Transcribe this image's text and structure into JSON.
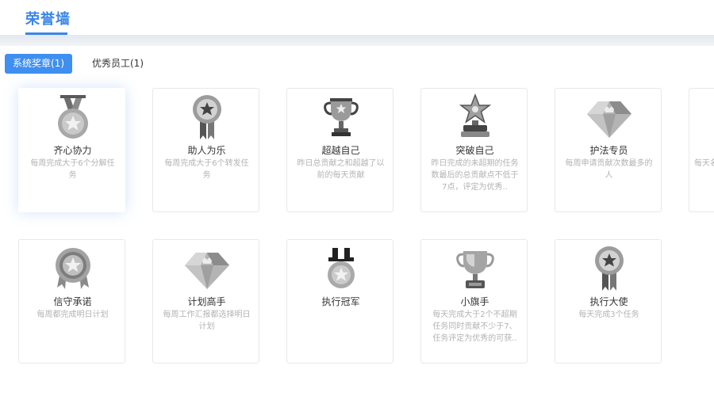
{
  "header": {
    "tab_label": "荣誉墙"
  },
  "filters": [
    {
      "label": "系统奖章(1)",
      "active": true
    },
    {
      "label": "优秀员工(1)",
      "active": false
    }
  ],
  "row1": [
    {
      "icon": "medal-ribbon-star-icon",
      "title": "齐心协力",
      "desc": "每周完成大于6个分解任务"
    },
    {
      "icon": "rosette-ribbon-icon",
      "title": "助人为乐",
      "desc": "每周完成大于6个转发任务"
    },
    {
      "icon": "trophy-cup-icon",
      "title": "超越自己",
      "desc": "昨日总贡献之和超越了以前的每天贡献"
    },
    {
      "icon": "star-trophy-icon",
      "title": "突破自己",
      "desc": "昨日完成的未超期的任务数最后的总贡献点不低于7点，评定为优秀.."
    },
    {
      "icon": "diamond-crown-icon",
      "title": "护法专员",
      "desc": "每周申请贡献次数最多的人"
    },
    {
      "icon": "partial-badge-icon",
      "title": "",
      "desc": "每天名前"
    }
  ],
  "row2": [
    {
      "icon": "rosette-star-ribbon-icon",
      "title": "信守承诺",
      "desc": "每周都完成明日计划"
    },
    {
      "icon": "diamond-crown-icon",
      "title": "计划高手",
      "desc": "每周工作汇报都选择明日计划"
    },
    {
      "icon": "tophat-medal-icon",
      "title": "执行冠军",
      "desc": ""
    },
    {
      "icon": "trophy-cup-icon",
      "title": "小旗手",
      "desc": "每天完成大于2个不超期任务同时贡献不少于7、任务评定为优秀的可获.."
    },
    {
      "icon": "rosette-ribbon-icon",
      "title": "执行大使",
      "desc": "每天完成3个任务"
    }
  ]
}
